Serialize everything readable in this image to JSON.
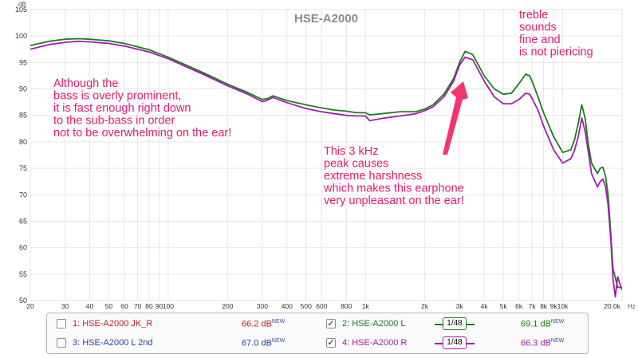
{
  "chart_data": {
    "type": "line",
    "title": "HSE-A2000",
    "ylabel": "dB",
    "xlabel": "Hz",
    "x_scale": "log",
    "xlim": [
      20,
      20000
    ],
    "ylim": [
      50,
      105
    ],
    "grid": true,
    "x_ticks": [
      20,
      30,
      40,
      50,
      60,
      70,
      80,
      90,
      100,
      200,
      300,
      400,
      500,
      600,
      800,
      1000,
      2000,
      3000,
      4000,
      5000,
      6000,
      7000,
      8000,
      9000,
      10000,
      20000
    ],
    "x_tick_labels": [
      "20",
      "30",
      "40",
      "50",
      "60",
      "70",
      "80",
      "90",
      "100",
      "200",
      "300",
      "400",
      "500",
      "600",
      "800",
      "1k",
      "2k",
      "3k",
      "4k",
      "5k",
      "6k",
      "7k",
      "8k",
      "9k",
      "10k",
      "20.0k"
    ],
    "y_ticks": [
      50,
      55,
      60,
      65,
      70,
      75,
      80,
      85,
      90,
      95,
      100,
      105
    ],
    "series": [
      {
        "name": "HSE-A2000 L",
        "color": "#1f7a1f",
        "x": [
          20,
          25,
          30,
          35,
          40,
          50,
          60,
          80,
          100,
          150,
          200,
          250,
          300,
          320,
          340,
          400,
          500,
          600,
          700,
          800,
          900,
          1000,
          1050,
          1200,
          1500,
          1800,
          2000,
          2200,
          2500,
          2800,
          3000,
          3200,
          3500,
          4000,
          4500,
          5000,
          5500,
          6000,
          6500,
          6800,
          7000,
          7500,
          8000,
          9000,
          10000,
          11000,
          11500,
          12000,
          12500,
          13000,
          13500,
          14000,
          15000,
          15500,
          16000,
          16500,
          17000,
          17500,
          18000,
          19000,
          20000
        ],
        "y": [
          98.2,
          99.0,
          99.4,
          99.5,
          99.4,
          99.1,
          98.6,
          97.4,
          96.0,
          93.1,
          90.9,
          89.4,
          88.0,
          88.2,
          88.7,
          87.8,
          87.0,
          86.4,
          86.0,
          85.8,
          85.5,
          85.5,
          85.1,
          85.3,
          85.7,
          85.7,
          86.2,
          87.0,
          89.0,
          92.0,
          95.0,
          97.1,
          96.5,
          92.5,
          90.0,
          89.0,
          89.2,
          91.0,
          92.8,
          92.5,
          91.5,
          88.5,
          85.5,
          81.0,
          78.0,
          78.5,
          80.5,
          83.5,
          87.0,
          84.5,
          79.5,
          76.0,
          74.0,
          75.0,
          75.2,
          73.5,
          70.0,
          63.0,
          56.0,
          52.5,
          52.5
        ]
      },
      {
        "name": "HSE-A2000 R",
        "color": "#a21caf",
        "x": [
          20,
          25,
          30,
          35,
          40,
          50,
          60,
          80,
          100,
          150,
          200,
          250,
          300,
          320,
          340,
          400,
          500,
          600,
          700,
          800,
          900,
          1000,
          1050,
          1200,
          1500,
          1800,
          2000,
          2200,
          2500,
          2800,
          3000,
          3200,
          3500,
          4000,
          4500,
          5000,
          5500,
          6000,
          6500,
          6800,
          7000,
          7500,
          8000,
          9000,
          10000,
          11000,
          11500,
          12000,
          12500,
          13000,
          13500,
          14000,
          15000,
          15500,
          16000,
          16500,
          17000,
          17500,
          18000,
          18500,
          19000,
          20000
        ],
        "y": [
          97.5,
          98.4,
          98.8,
          99.0,
          98.9,
          98.6,
          98.1,
          97.0,
          95.7,
          92.8,
          90.6,
          89.1,
          87.6,
          87.9,
          88.4,
          87.4,
          86.3,
          85.7,
          85.3,
          85.0,
          84.9,
          84.9,
          84.0,
          84.4,
          84.9,
          85.3,
          85.9,
          86.6,
          88.5,
          91.5,
          94.5,
          96.0,
          95.5,
          91.5,
          88.5,
          87.2,
          87.2,
          88.0,
          89.2,
          89.0,
          88.2,
          86.0,
          83.0,
          78.5,
          76.0,
          76.8,
          78.5,
          81.0,
          84.5,
          82.0,
          78.0,
          74.0,
          71.5,
          72.5,
          73.0,
          71.5,
          68.0,
          62.0,
          54.0,
          50.7,
          54.5,
          52.0
        ]
      }
    ],
    "annotations": [
      {
        "lines": [
          "Although the",
          "bass is overly prominent,",
          "it is fast enough right down",
          "to the sub-bass in order",
          "not to be overwhelming on the ear!"
        ]
      },
      {
        "lines": [
          "This 3 kHz",
          "peak causes",
          "extreme harshness",
          "which makes this earphone",
          "very unpleasant on the ear!"
        ]
      },
      {
        "lines": [
          "treble",
          "sounds",
          "fine and",
          "is not piericing"
        ]
      }
    ]
  },
  "legend": {
    "items": [
      {
        "label": "1: HSE-A2000 JK_R",
        "value": "66.2 dB",
        "badge": "NEW",
        "checked": false,
        "check_mark": "",
        "color": "#c0202a",
        "smoothing": ""
      },
      {
        "label": "2: HSE-A2000 L",
        "value": "69.1 dB",
        "badge": "NEW",
        "checked": true,
        "check_mark": "✓",
        "color": "#1f7a1f",
        "smoothing": "1/48"
      },
      {
        "label": "3: HSE-A2000 L 2nd",
        "value": "67.0 dB",
        "badge": "NEW",
        "checked": false,
        "check_mark": "",
        "color": "#2b3fa8",
        "smoothing": ""
      },
      {
        "label": "4: HSE-A2000 R",
        "value": "66.3 dB",
        "badge": "NEW",
        "checked": true,
        "check_mark": "✓",
        "color": "#a21caf",
        "smoothing": "1/48"
      }
    ]
  },
  "colors": {
    "annotation_text": "#e5186f",
    "annotation_bg": "#ffffff",
    "arrow": "#f2356e",
    "grid": "#e6e6e6",
    "plot_border": "#9a9a9a",
    "title_color": "#8a8a8a"
  }
}
